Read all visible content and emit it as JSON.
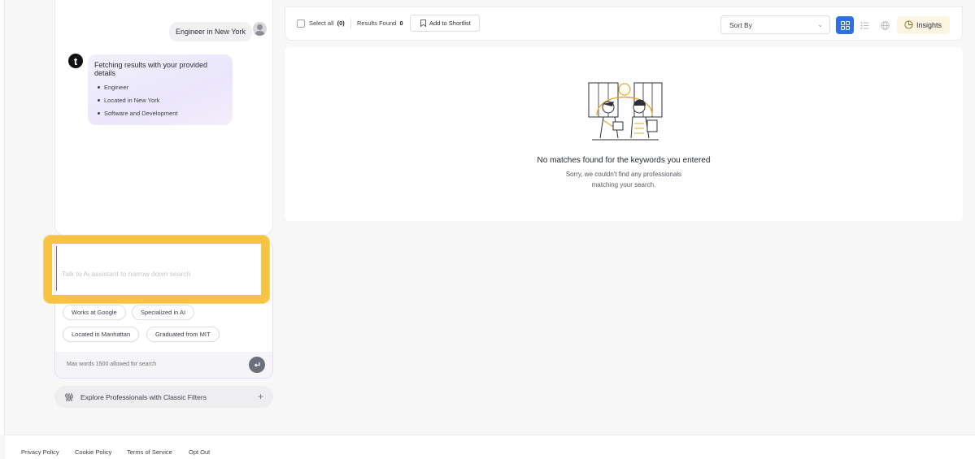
{
  "chat": {
    "user_message": "Engineer in New York",
    "bot_logo_letter": "t",
    "bot_title": "Fetching results with your provided details",
    "bot_items": [
      "Engineer",
      "Located in New York",
      "Software and Development"
    ]
  },
  "assistant_input": {
    "placeholder": "Talk to Ai assistant to narrow down search",
    "value": ""
  },
  "suggestions": [
    "Works at Google",
    "Specialized in AI",
    "Located in Manhattan",
    "Graduated from MIT"
  ],
  "input_footer": {
    "max_words": "Max words 1500 allowed for search"
  },
  "explore": {
    "label": "Explore Professionals with Classic Filters",
    "icon": "sliders-icon"
  },
  "toolbar": {
    "select_all_label": "Select all",
    "select_all_count": "(0)",
    "results_found_label": "Results Found",
    "results_found_count": "0",
    "shortlist_label": "Add to Shortlist",
    "sort_label": "Sort By",
    "insights_label": "Insights"
  },
  "empty_state": {
    "title": "No matches found for the keywords you entered",
    "line1": "Sorry, we couldn't find any professionals",
    "line2": "matching your search."
  },
  "footer": {
    "links": [
      "Privacy Policy",
      "Cookie Policy",
      "Terms of Service",
      "Opt Out"
    ]
  },
  "colors": {
    "accent": "#2f6fe5",
    "highlight": "#f6c343",
    "insights_bg": "#fbf5e2"
  }
}
